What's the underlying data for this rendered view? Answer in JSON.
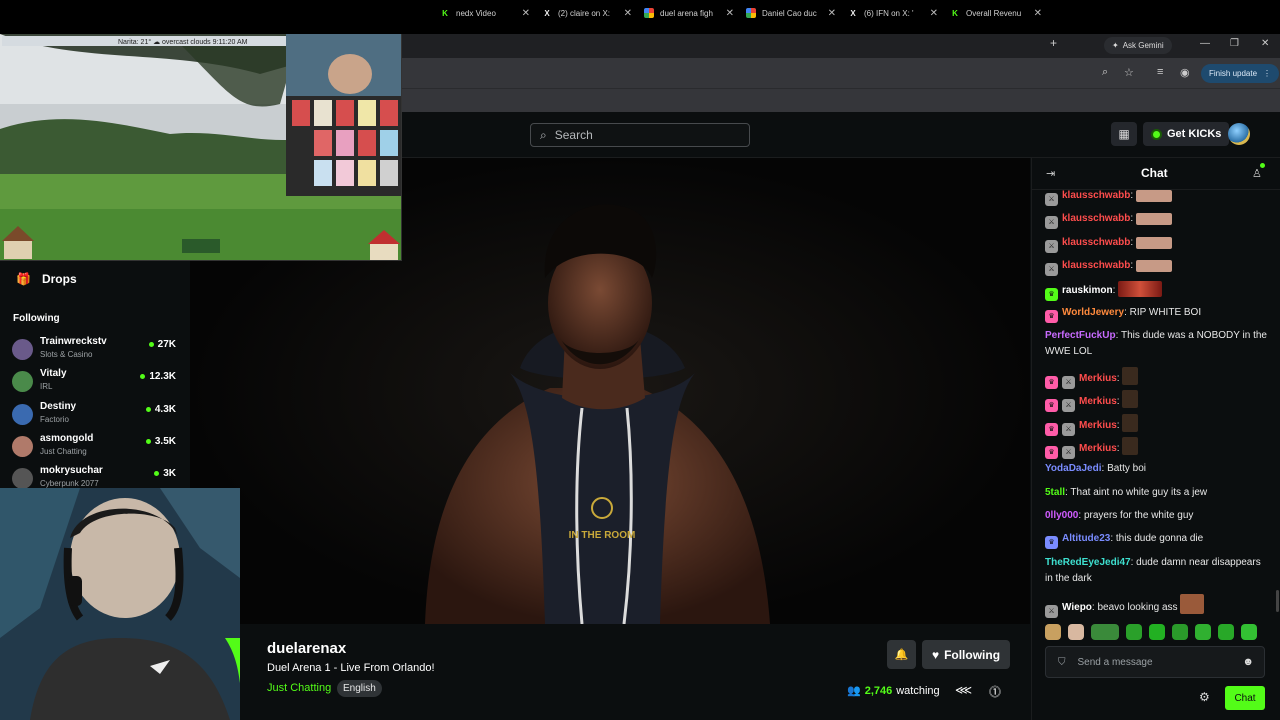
{
  "browser": {
    "tabs": [
      {
        "label": "nedx Video",
        "icon": "kick-favicon"
      },
      {
        "label": "(2) claire on X:",
        "icon": "x-favicon"
      },
      {
        "label": "duel arena figh",
        "icon": "google-favicon"
      },
      {
        "label": "Daniel Cao duc",
        "icon": "google-favicon"
      },
      {
        "label": "(6) IFN on X: '",
        "icon": "x-favicon"
      },
      {
        "label": "Overall Revenu",
        "icon": "kick-favicon"
      }
    ],
    "gemini_label": "Ask Gemini",
    "finish_update_label": "Finish update"
  },
  "header": {
    "search_placeholder": "Search",
    "get_kicks_label": "Get KICKs"
  },
  "weather_overlay": {
    "text": "Narita: 21°  ☁  overcast clouds 9:11:20 AM"
  },
  "sidebar": {
    "drops_label": "Drops",
    "following_label": "Following",
    "channels": [
      {
        "name": "Trainwreckstv",
        "category": "Slots & Casino",
        "viewers": "27K",
        "color": "#6a5a8a"
      },
      {
        "name": "Vitaly",
        "category": "IRL",
        "viewers": "12.3K",
        "color": "#4a8a4a"
      },
      {
        "name": "Destiny",
        "category": "Factorio",
        "viewers": "4.3K",
        "color": "#3a6ab0"
      },
      {
        "name": "asmongold",
        "category": "Just Chatting",
        "viewers": "3.5K",
        "color": "#b07a6a"
      },
      {
        "name": "mokrysuchar",
        "category": "Cyberpunk 2077",
        "viewers": "3K",
        "color": "#555"
      }
    ]
  },
  "channel": {
    "name": "duelarenax",
    "title": "Duel Arena 1 - Live From Orlando!",
    "category": "Just Chatting",
    "language": "English",
    "following_label": "Following",
    "viewers": "2,746",
    "watching_label": "watching"
  },
  "chat": {
    "title": "Chat",
    "messages": [
      {
        "user": "klausschwabb",
        "color": "#ff4d4d",
        "text": "",
        "badge": "sword",
        "emote": "hand"
      },
      {
        "user": "klausschwabb",
        "color": "#ff4d4d",
        "text": "",
        "badge": "sword",
        "emote": "hand"
      },
      {
        "user": "klausschwabb",
        "color": "#ff4d4d",
        "text": "",
        "badge": "sword",
        "emote": "hand"
      },
      {
        "user": "klausschwabb",
        "color": "#ff4d4d",
        "text": "",
        "badge": "sword",
        "emote": "hand"
      },
      {
        "user": "rauskimon",
        "color": "#ffffff",
        "text": "",
        "badge": "sub-green",
        "emote": "red"
      },
      {
        "user": "WorldJewery",
        "color": "#ff8a3d",
        "text": "RIP WHITE BOI",
        "badge": "sub-pink",
        "emote": ""
      },
      {
        "user": "PerfectFuckUp",
        "color": "#c86bff",
        "text": "This dude was a NOBODY in the WWE LOL",
        "badge": "",
        "emote": ""
      },
      {
        "user": "Merkius",
        "color": "#ff4d4d",
        "text": "",
        "badge": "sub-pink",
        "emote": "dark"
      },
      {
        "user": "Merkius",
        "color": "#ff4d4d",
        "text": "",
        "badge": "sub-pink",
        "emote": "dark"
      },
      {
        "user": "Merkius",
        "color": "#ff4d4d",
        "text": "",
        "badge": "sub-pink",
        "emote": "dark"
      },
      {
        "user": "Merkius",
        "color": "#ff4d4d",
        "text": "",
        "badge": "sub-pink",
        "emote": "dark"
      },
      {
        "user": "YodaDaJedi",
        "color": "#7a8cff",
        "text": "Batty boi",
        "badge": "",
        "emote": ""
      },
      {
        "user": "5tall",
        "color": "#53fc18",
        "text": "That aint no white guy its a jew",
        "badge": "",
        "emote": ""
      },
      {
        "user": "0lly000",
        "color": "#d05cff",
        "text": "prayers for the white guy",
        "badge": "",
        "emote": ""
      },
      {
        "user": "Altitude23",
        "color": "#7a8cff",
        "text": "this dude gonna die",
        "badge": "sub-blue",
        "emote": ""
      },
      {
        "user": "TheRedEyeJedi47",
        "color": "#3ee0d0",
        "text": "dude damn near disappears in the dark",
        "badge": "",
        "emote": ""
      },
      {
        "user": "Wiepo",
        "color": "#ffffff",
        "text": "beavo looking ass",
        "badge": "sword",
        "emote": "face"
      }
    ],
    "input_placeholder": "Send a message",
    "send_label": "Chat"
  }
}
